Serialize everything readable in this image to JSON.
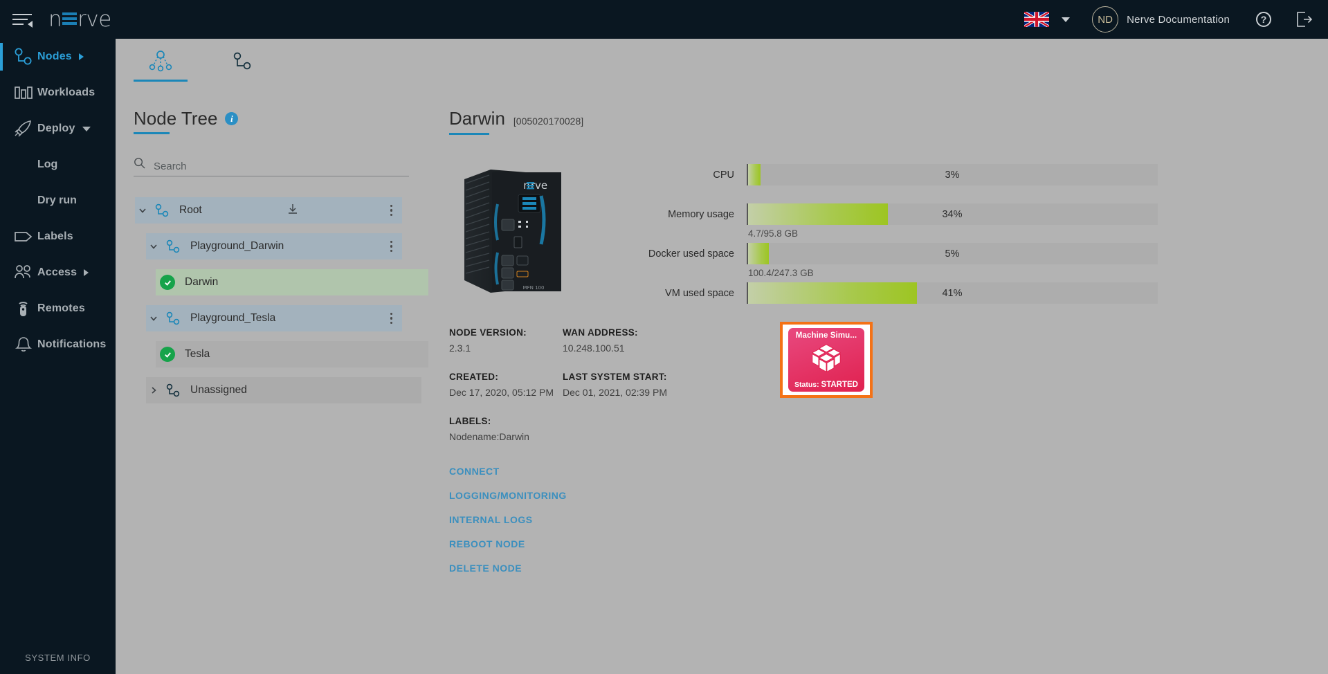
{
  "topbar": {
    "menu_icon": "hamburger-icon",
    "logo_text_1": "n",
    "logo_text_2": "rve",
    "language": "English (UK)",
    "avatar_initials": "ND",
    "username": "Nerve Documentation",
    "help_glyph": "?",
    "logout_icon": "logout-icon"
  },
  "sidebar": {
    "items": [
      {
        "label": "Nodes",
        "icon": "nodes-icon",
        "active": true,
        "caret": "right"
      },
      {
        "label": "Workloads",
        "icon": "workloads-icon",
        "active": false,
        "caret": "none"
      },
      {
        "label": "Deploy",
        "icon": "deploy-rocket-icon",
        "active": false,
        "caret": "down"
      }
    ],
    "sub_items": [
      {
        "label": "Log"
      },
      {
        "label": "Dry run"
      }
    ],
    "items2": [
      {
        "label": "Labels",
        "icon": "label-tag-icon",
        "active": false,
        "caret": "none"
      },
      {
        "label": "Access",
        "icon": "users-icon",
        "active": false,
        "caret": "right"
      },
      {
        "label": "Remotes",
        "icon": "remote-control-icon",
        "active": false,
        "caret": "none"
      },
      {
        "label": "Notifications",
        "icon": "bell-icon",
        "active": false,
        "caret": "none"
      }
    ],
    "system_info": "SYSTEM INFO"
  },
  "tabs": [
    {
      "name": "tree-view-tab",
      "icon": "node-tree-icon",
      "active": true
    },
    {
      "name": "node-list-tab",
      "icon": "node-list-icon",
      "active": false
    }
  ],
  "tree_panel": {
    "title": "Node Tree",
    "info_glyph": "i",
    "search": {
      "value": "",
      "placeholder": "Search"
    },
    "rows": [
      {
        "label": "Root",
        "type": "root",
        "expanded": true,
        "chevron": "down",
        "icon": "node-group-icon",
        "has_download": true,
        "has_menu": true
      },
      {
        "label": "Playground_Darwin",
        "type": "group",
        "expanded": true,
        "chevron": "down",
        "icon": "node-group-icon",
        "has_download": false,
        "has_menu": true
      },
      {
        "label": "Darwin",
        "type": "node",
        "selected": true,
        "icon": "status-ok-icon",
        "has_menu": false
      },
      {
        "label": "Playground_Tesla",
        "type": "group",
        "expanded": true,
        "chevron": "down",
        "icon": "node-group-icon",
        "has_download": false,
        "has_menu": true
      },
      {
        "label": "Tesla",
        "type": "node",
        "selected": false,
        "icon": "status-ok-icon",
        "has_menu": false
      },
      {
        "label": "Unassigned",
        "type": "group",
        "expanded": false,
        "chevron": "right",
        "icon": "node-group-icon",
        "has_download": false,
        "has_menu": false
      }
    ]
  },
  "detail": {
    "title": "Darwin",
    "serial": "[005020170028]",
    "device_image_label": "MFN 100",
    "gauges": [
      {
        "label": "CPU",
        "percent_text": "3%",
        "percent": 3,
        "sub": ""
      },
      {
        "label": "Memory usage",
        "percent_text": "34%",
        "percent": 34,
        "sub": "4.7/95.8 GB"
      },
      {
        "label": "Docker used space",
        "percent_text": "5%",
        "percent": 5,
        "sub": "100.4/247.3 GB"
      },
      {
        "label": "VM used space",
        "percent_text": "41%",
        "percent": 41,
        "sub": ""
      }
    ],
    "meta": {
      "node_version_key": "NODE VERSION:",
      "node_version_value": "2.3.1",
      "wan_address_key": "WAN ADDRESS:",
      "wan_address_value": "10.248.100.51",
      "created_key": "CREATED:",
      "created_value": "Dec 17, 2020, 05:12 PM",
      "last_start_key": "LAST SYSTEM START:",
      "last_start_value": "Dec 01, 2021, 02:39 PM",
      "labels_key": "LABELS:",
      "labels_value": "Nodename:Darwin"
    },
    "workload": {
      "name": "Machine Simu...",
      "status_prefix": "Status: ",
      "status": "STARTED",
      "icon": "docker-cube-icon",
      "border_color": "#f47216",
      "tile_color": "#e0214f"
    },
    "actions": [
      {
        "label": "CONNECT"
      },
      {
        "label": "LOGGING/MONITORING"
      },
      {
        "label": "INTERNAL LOGS"
      },
      {
        "label": "REBOOT NODE"
      },
      {
        "label": "DELETE NODE"
      }
    ]
  },
  "colors": {
    "accent_blue": "#2b9fd8",
    "link_blue": "#3b8fbe",
    "dark_bg": "#0a1721",
    "page_bg": "#b3b3b3",
    "gauge_green": "#9dc522",
    "status_green": "#16a34a",
    "workload_orange": "#f47216",
    "workload_pink": "#e0214f"
  }
}
